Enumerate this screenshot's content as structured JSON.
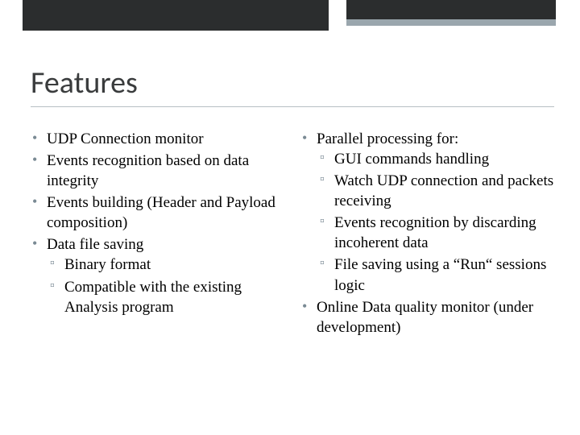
{
  "title": "Features",
  "left": {
    "items": [
      {
        "text": "UDP Connection monitor"
      },
      {
        "text": "Events recognition based on data integrity"
      },
      {
        "text": "Events building (Header and Payload composition)"
      },
      {
        "text": "Data file saving",
        "sub": [
          "Binary format",
          "Compatible with the existing Analysis program"
        ]
      }
    ]
  },
  "right": {
    "items": [
      {
        "text": "Parallel processing for:",
        "sub": [
          "GUI commands handling",
          "Watch UDP connection and packets receiving",
          "Events recognition by discarding incoherent data",
          "File saving using a “Run“ sessions logic"
        ]
      },
      {
        "text": "Online Data quality monitor (under development)"
      }
    ]
  }
}
